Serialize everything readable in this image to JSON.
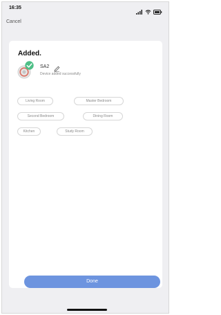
{
  "status_bar": {
    "time": "16:35",
    "icons": [
      "signal-icon",
      "wifi-icon",
      "battery-icon"
    ]
  },
  "header": {
    "cancel_label": "Cancel"
  },
  "card": {
    "title": "Added.",
    "device": {
      "name": "SA2",
      "status": "Device added successfully",
      "icon": "device-icon",
      "badge_icon": "check-icon",
      "edit_icon": "pencil-icon"
    },
    "rooms": [
      "Living Room",
      "Master Bedroom",
      "Second Bedroom",
      "Dining Room",
      "Kitchen",
      "Study Room"
    ],
    "done_label": "Done"
  },
  "colors": {
    "accent": "#6d94df",
    "success": "#4fbf87",
    "background": "#efeff2"
  }
}
